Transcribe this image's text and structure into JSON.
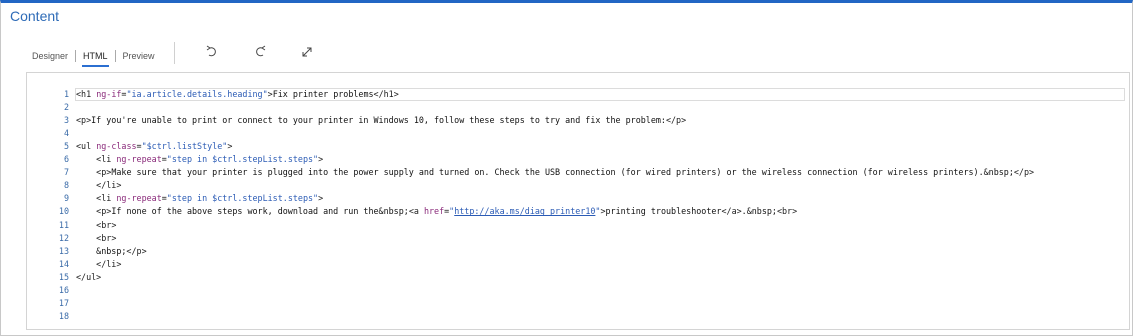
{
  "header": {
    "title": "Content"
  },
  "tabs": [
    {
      "label": "Designer",
      "active": false
    },
    {
      "label": "HTML",
      "active": true
    },
    {
      "label": "Preview",
      "active": false
    }
  ],
  "toolbar": {
    "icons": [
      "undo-icon",
      "redo-icon",
      "expand-icon"
    ]
  },
  "editor": {
    "line_numbers": [
      "1",
      "2",
      "3",
      "4",
      "5",
      "6",
      "7",
      "8",
      "9",
      "10",
      "11",
      "12",
      "13",
      "14",
      "15",
      "16",
      "17",
      "18"
    ],
    "lines": [
      "<h1 ng-if=\"ia.article.details.heading\">Fix printer problems</h1>",
      "",
      "<p>If you're unable to print or connect to your printer in Windows 10, follow these steps to try and fix the problem:</p>",
      "",
      "<ul ng-class=\"$ctrl.listStyle\">",
      "    <li ng-repeat=\"step in $ctrl.stepList.steps\">",
      "    <p>Make sure that your printer is plugged into the power supply and turned on. Check the USB connection (for wired printers) or the wireless connection (for wireless printers).&nbsp;</p>",
      "    </li>",
      "    <li ng-repeat=\"step in $ctrl.stepList.steps\">",
      "    <p>If none of the above steps work, download and run the&nbsp;<a href=\"http://aka.ms/diag_printer10\">printing troubleshooter</a>.&nbsp;<br>",
      "    <br>",
      "    <br>",
      "    &nbsp;</p>",
      "    </li>",
      "</ul>",
      "",
      "",
      ""
    ],
    "link_text": "http://aka.ms/diag_printer10"
  }
}
